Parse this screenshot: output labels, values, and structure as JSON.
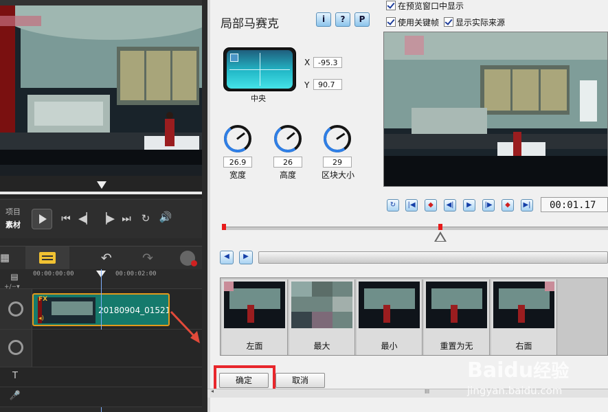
{
  "left_panel": {
    "mode_labels": [
      "项目",
      "素材"
    ],
    "ruler_times": [
      "00:00:00:00",
      "00:00:02:00"
    ],
    "clip": {
      "fx_badge": "FX",
      "name": "20180904_01521"
    }
  },
  "dialog": {
    "title": "局部马赛克",
    "top_buttons": [
      "i",
      "?",
      "P"
    ],
    "options": [
      "在预览窗口中显示",
      "使用关键帧",
      "显示实际来源"
    ],
    "position_label": "中央",
    "x_label": "X",
    "x_value": "-95.3",
    "y_label": "Y",
    "y_value": "90.7",
    "dials": [
      {
        "value": "26.9",
        "label": "宽度",
        "level": 0.35
      },
      {
        "value": "26",
        "label": "高度",
        "level": 0.34
      },
      {
        "value": "29",
        "label": "区块大小",
        "level": 0.38
      }
    ],
    "timecode": "00:01.17",
    "presets": [
      "左面",
      "最大",
      "最小",
      "重置为无",
      "右面"
    ],
    "ok_label": "确定",
    "cancel_label": "取消",
    "scroll_mark": "III"
  },
  "watermark": {
    "brand": "Baidu",
    "brand_cn": "经验",
    "url": "jingyan.baidu.com"
  },
  "colors": {
    "clip_fill": "#157a6c",
    "clip_border": "#e29a1c",
    "highlight_red": "#e8262b",
    "arrow_red": "#e24a3a"
  }
}
